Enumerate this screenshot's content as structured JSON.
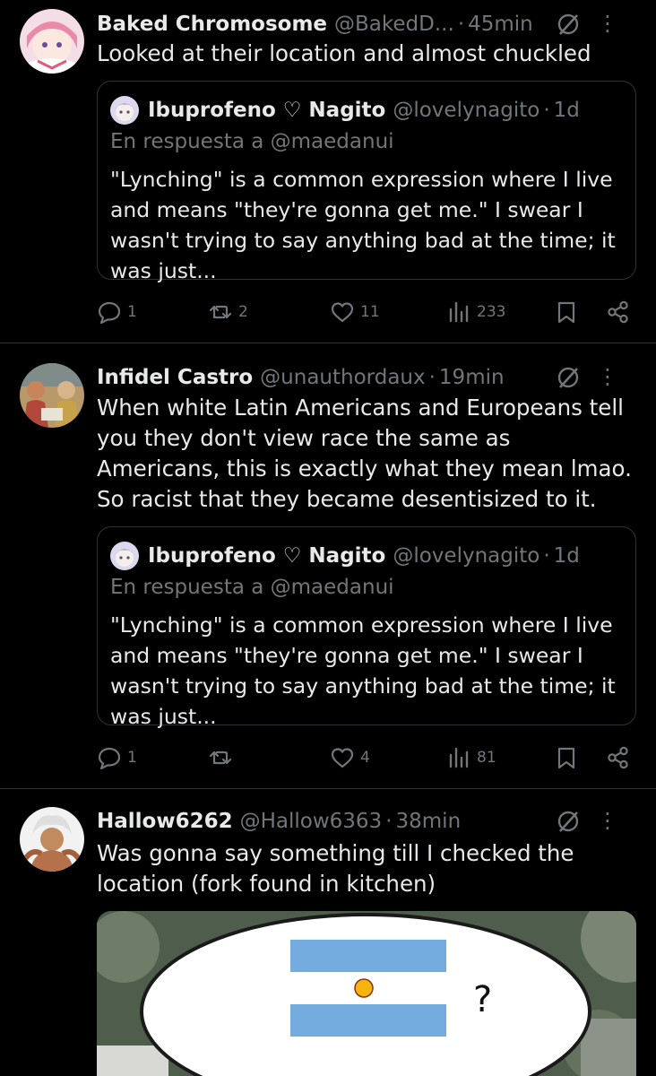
{
  "tweets": [
    {
      "author_name": "Baked Chromosome",
      "author_handle": "@BakedD...",
      "time": "45min",
      "text": "Looked at their location and almost chuckled",
      "quote": {
        "author_name": "Ibuprofeno ♡ Nagito",
        "author_handle": "@lovelynagito",
        "time": "1d",
        "reply_to": "En respuesta a @maedanui",
        "text": "\"Lynching\" is a common expression where I live and means \"they're gonna get me.\" I swear I wasn't trying to say anything bad at the time; it was just..."
      },
      "stats": {
        "replies": "1",
        "reposts": "2",
        "likes": "11",
        "views": "233"
      }
    },
    {
      "author_name": "Infidel Castro",
      "author_handle": "@unauthordaux",
      "time": "19min",
      "text": "When white Latin Americans and Europeans tell you they don't view race the same as Americans, this is exactly what they mean lmao. So racist that they became desentisized to it.",
      "quote": {
        "author_name": "Ibuprofeno ♡ Nagito",
        "author_handle": "@lovelynagito",
        "time": "1d",
        "reply_to": "En respuesta a @maedanui",
        "text": "\"Lynching\" is a common expression where I live and means \"they're gonna get me.\" I swear I wasn't trying to say anything bad at the time; it was just..."
      },
      "stats": {
        "replies": "1",
        "reposts": "",
        "likes": "4",
        "views": "81"
      }
    },
    {
      "author_name": "Hallow6262",
      "author_handle": "@Hallow6363",
      "time": "38min",
      "text": "Was gonna say something till I checked the location (fork found in kitchen)",
      "media": {
        "bubble_text": "?"
      }
    }
  ],
  "ui": {
    "separator": "·",
    "more_glyph": "⋮"
  },
  "icons": {
    "reply": "reply-icon",
    "repost": "repost-icon",
    "like": "heart-icon",
    "views": "views-icon",
    "bookmark": "bookmark-icon",
    "share": "share-icon",
    "grok": "grok-icon",
    "more": "more-icon"
  },
  "colors": {
    "background": "#000000",
    "text_primary": "#e7e9ea",
    "text_secondary": "#71767b",
    "border": "#2f3336",
    "flag_blue": "#74acdf",
    "flag_sun": "#f6b40e"
  }
}
